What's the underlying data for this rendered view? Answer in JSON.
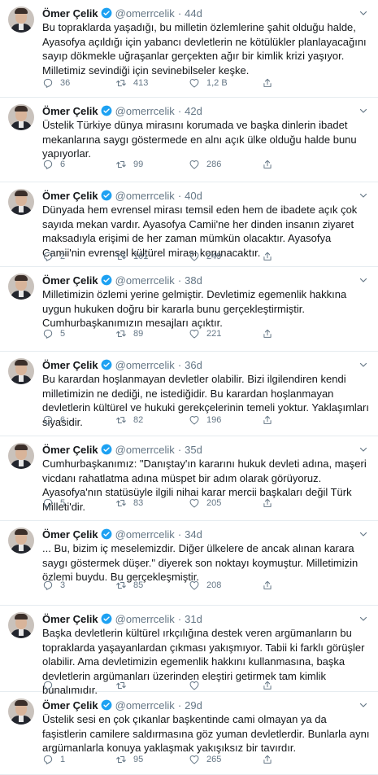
{
  "colors": {
    "text": "#14171a",
    "secondary": "#657786",
    "verified": "#1da1f2",
    "divider": "#e6ecf0"
  },
  "icons": {
    "verified": "verified-badge-icon",
    "reply": "reply-icon",
    "retweet": "retweet-icon",
    "like": "heart-icon",
    "share": "share-icon",
    "menu": "chevron-down-icon"
  },
  "tweets": [
    {
      "name": "Ömer Çelik",
      "handle": "@omerrcelik",
      "dot": "·",
      "time": "44d",
      "text": "Bu topraklarda yaşadığı, bu milletin özlemlerine şahit olduğu halde, Ayasofya açıldığı için yabancı devletlerin ne kötülükler planlayacağını sayıp dökmekle uğraşanlar gerçekten ağır bir kimlik krizi yaşıyor. Milletimiz sevindiği için sevinebilseler keşke.",
      "replies": "36",
      "retweets": "413",
      "likes": "1,2 B"
    },
    {
      "name": "Ömer Çelik",
      "handle": "@omerrcelik",
      "dot": "·",
      "time": "42d",
      "text": "Üstelik Türkiye dünya mirasını korumada ve başka dinlerin ibadet mekanlarına saygı göstermede en alnı açık ülke olduğu halde bunu yapıyorlar.",
      "replies": "6",
      "retweets": "99",
      "likes": "286"
    },
    {
      "name": "Ömer Çelik",
      "handle": "@omerrcelik",
      "dot": "·",
      "time": "40d",
      "text": "Dünyada hem evrensel mirası temsil eden hem de ibadete açık çok sayıda mekan vardır. Ayasofya Camii'ne her dinden insanın ziyaret maksadıyla erişimi de her zaman mümkün olacaktır. Ayasofya Camii'nin evrensel kültürel mirası korunacaktır.",
      "replies": "2",
      "retweets": "101",
      "likes": "249"
    },
    {
      "name": "Ömer Çelik",
      "handle": "@omerrcelik",
      "dot": "·",
      "time": "38d",
      "text": "Milletimizin özlemi yerine gelmiştir. Devletimiz egemenlik hakkına uygun hukuken doğru bir kararla bunu gerçekleştirmiştir. Cumhurbaşkanımızın mesajları açıktır.",
      "replies": "5",
      "retweets": "89",
      "likes": "221"
    },
    {
      "name": "Ömer Çelik",
      "handle": "@omerrcelik",
      "dot": "·",
      "time": "36d",
      "text": "Bu karardan hoşlanmayan devletler olabilir. Bizi ilgilendiren kendi milletimizin ne dediği, ne istediğidir. Bu karardan hoşlanmayan devletlerin kültürel ve hukuki gerekçelerinin temeli yoktur. Yaklaşımları siyasidir.",
      "replies": "6",
      "retweets": "82",
      "likes": "196"
    },
    {
      "name": "Ömer Çelik",
      "handle": "@omerrcelik",
      "dot": "·",
      "time": "35d",
      "text": "Cumhurbaşkanımız: \"Danıştay'ın kararını hukuk devleti adına, maşeri vicdanı rahatlatma adına müspet bir adım olarak görüyoruz. Ayasofya'nın statüsüyle ilgili nihai karar mercii başkaları değil Türk Milleti'dir.",
      "replies": "5",
      "retweets": "83",
      "likes": "205"
    },
    {
      "name": "Ömer Çelik",
      "handle": "@omerrcelik",
      "dot": "·",
      "time": "34d",
      "text": "... Bu, bizim iç meselemizdir. Diğer ülkelere de ancak alınan karara saygı göstermek düşer.\" diyerek son noktayı koymuştur. Milletimizin özlemi buydu. Bu gerçekleşmiştir.",
      "replies": "3",
      "retweets": "85",
      "likes": "208"
    },
    {
      "name": "Ömer Çelik",
      "handle": "@omerrcelik",
      "dot": "·",
      "time": "31d",
      "text": "Başka devletlerin kültürel ırkçılığına destek veren argümanların bu topraklarda yaşayanlardan çıkması yakışmıyor. Tabii ki farklı görüşler olabilir. Ama devletimizin egemenlik hakkını kullanmasına, başka devletlerin argümanları üzerinden eleştiri getirmek tam kimlik bunalımıdır.",
      "replies": "",
      "retweets": "",
      "likes": ""
    },
    {
      "name": "Ömer Çelik",
      "handle": "@omerrcelik",
      "dot": "·",
      "time": "29d",
      "text": "Üstelik sesi en çok çıkanlar başkentinde cami olmayan ya da faşistlerin camilere saldırmasına göz yuman devletlerdir. Bunlarla aynı argümanlarla konuya yaklaşmak yakışıksız bir tavırdır.",
      "replies": "1",
      "retweets": "95",
      "likes": "265"
    }
  ]
}
